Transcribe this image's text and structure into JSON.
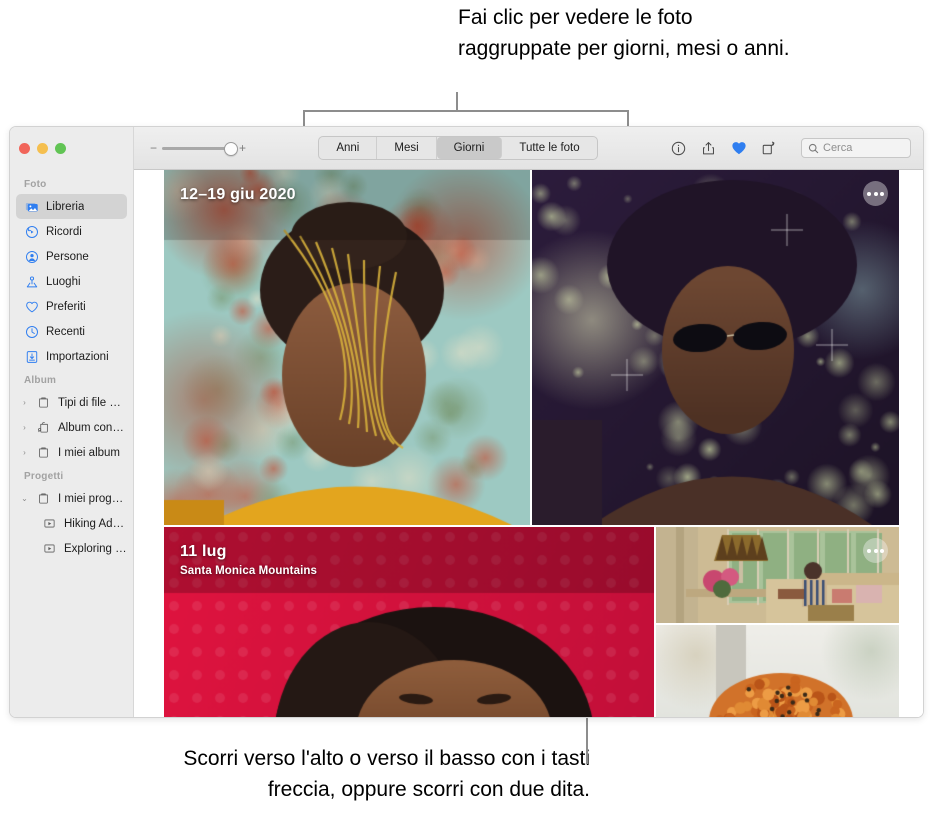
{
  "annotations": {
    "top": "Fai clic per vedere le foto raggruppate per giorni, mesi o anni.",
    "bottom_line1": "Scorri verso l'alto o verso il basso con i tasti",
    "bottom_line2": "freccia, oppure scorri con due dita."
  },
  "window": {
    "traffic_lights": {
      "close": "close-button",
      "minimize": "minimize-button",
      "zoom": "maximize-button"
    }
  },
  "sidebar": {
    "groups": [
      {
        "title": "Foto",
        "items": [
          {
            "label": "Libreria",
            "icon": "library-icon",
            "selected": true,
            "twisty": ""
          },
          {
            "label": "Ricordi",
            "icon": "memories-icon",
            "selected": false,
            "twisty": ""
          },
          {
            "label": "Persone",
            "icon": "people-icon",
            "selected": false,
            "twisty": ""
          },
          {
            "label": "Luoghi",
            "icon": "places-icon",
            "selected": false,
            "twisty": ""
          },
          {
            "label": "Preferiti",
            "icon": "heart-icon",
            "selected": false,
            "twisty": ""
          },
          {
            "label": "Recenti",
            "icon": "clock-icon",
            "selected": false,
            "twisty": ""
          },
          {
            "label": "Importazioni",
            "icon": "import-icon",
            "selected": false,
            "twisty": ""
          }
        ]
      },
      {
        "title": "Album",
        "items": [
          {
            "label": "Tipi di file multi...",
            "icon": "folder-icon",
            "selected": false,
            "twisty": "›"
          },
          {
            "label": "Album condivisi",
            "icon": "shared-folder-icon",
            "selected": false,
            "twisty": "›"
          },
          {
            "label": "I miei album",
            "icon": "folder-icon",
            "selected": false,
            "twisty": "›"
          }
        ]
      },
      {
        "title": "Progetti",
        "items": [
          {
            "label": "I miei progetti",
            "icon": "folder-icon",
            "selected": false,
            "twisty": "⌄"
          },
          {
            "label": "Hiking Adve...",
            "icon": "slideshow-icon",
            "selected": false,
            "twisty": "",
            "sub": true
          },
          {
            "label": "Exploring M...",
            "icon": "slideshow-icon",
            "selected": false,
            "twisty": "",
            "sub": true
          }
        ]
      }
    ]
  },
  "toolbar": {
    "zoom_slider": {
      "minus": "−",
      "plus": "+",
      "value": 88
    },
    "segments": [
      {
        "label": "Anni",
        "active": false
      },
      {
        "label": "Mesi",
        "active": false
      },
      {
        "label": "Giorni",
        "active": true
      },
      {
        "label": "Tutte le foto",
        "active": false
      }
    ],
    "icons": [
      {
        "name": "info-icon",
        "active": false
      },
      {
        "name": "share-icon",
        "active": false
      },
      {
        "name": "heart-icon",
        "active": true
      },
      {
        "name": "rotate-icon",
        "active": false
      }
    ],
    "search": {
      "placeholder": "Cerca",
      "value": "",
      "icon": "search-icon"
    },
    "accent_color": "#2f7ef0"
  },
  "grid": {
    "groups": [
      {
        "title": "12–19 giu 2020",
        "subtitle": "",
        "more_label": "•••"
      },
      {
        "title": "11 lug",
        "subtitle": "Santa Monica Mountains",
        "more_label": "•••"
      }
    ]
  }
}
